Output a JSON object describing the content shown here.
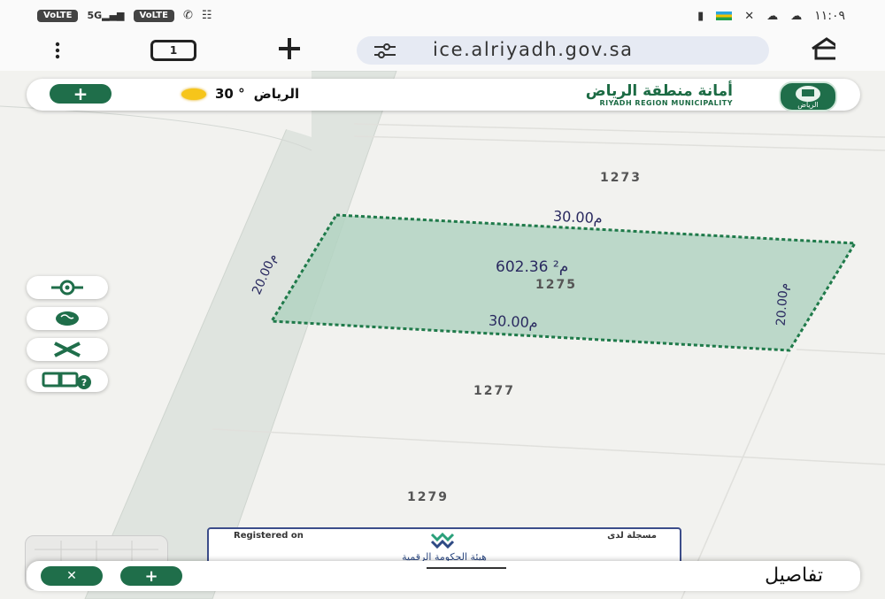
{
  "status_bar": {
    "left_badges": [
      "VoLTE",
      "5G",
      "VoLTE"
    ],
    "time": "١١:٠٩",
    "right_icons": [
      "battery-icon",
      "flag-icon",
      "x-social-icon",
      "snapchat-icon",
      "snapchat-icon"
    ]
  },
  "browser": {
    "tab_count": "1",
    "url": "ice.alriyadh.gov.sa"
  },
  "header": {
    "add_label": "+",
    "weather_temp": "30 °",
    "weather_city": "الرياض",
    "logo_arabic": "أمانة منطقة الرياض",
    "logo_english": "RIYADH REGION MUNICIPALITY",
    "seal_text": "الرياض"
  },
  "map": {
    "plots": [
      {
        "number": "1273"
      },
      {
        "number": "1275",
        "area": "602.36 م²",
        "top_length": "30.00م",
        "bottom_length": "30.00م",
        "left_length": "20.00م",
        "right_length": "20.00م"
      },
      {
        "number": "1277"
      },
      {
        "number": "1279"
      }
    ],
    "colors": {
      "plot_fill": "#b3d4c2",
      "plot_border": "#1f7a4a",
      "street": "#dfe4df",
      "accent": "#1f6e4a"
    }
  },
  "map_controls": [
    {
      "icon": "locate-icon"
    },
    {
      "icon": "globe-icon"
    },
    {
      "icon": "tools-icon"
    },
    {
      "icon": "help-layers-icon"
    }
  ],
  "info_card": {
    "registered_en": "Registered on",
    "registered_ar": "مسجلة لدى",
    "org": "هيئة الحكومة الرقمية"
  },
  "bottom_sheet": {
    "title": "تفاصيل",
    "close_label": "✕",
    "add_label": "+"
  }
}
